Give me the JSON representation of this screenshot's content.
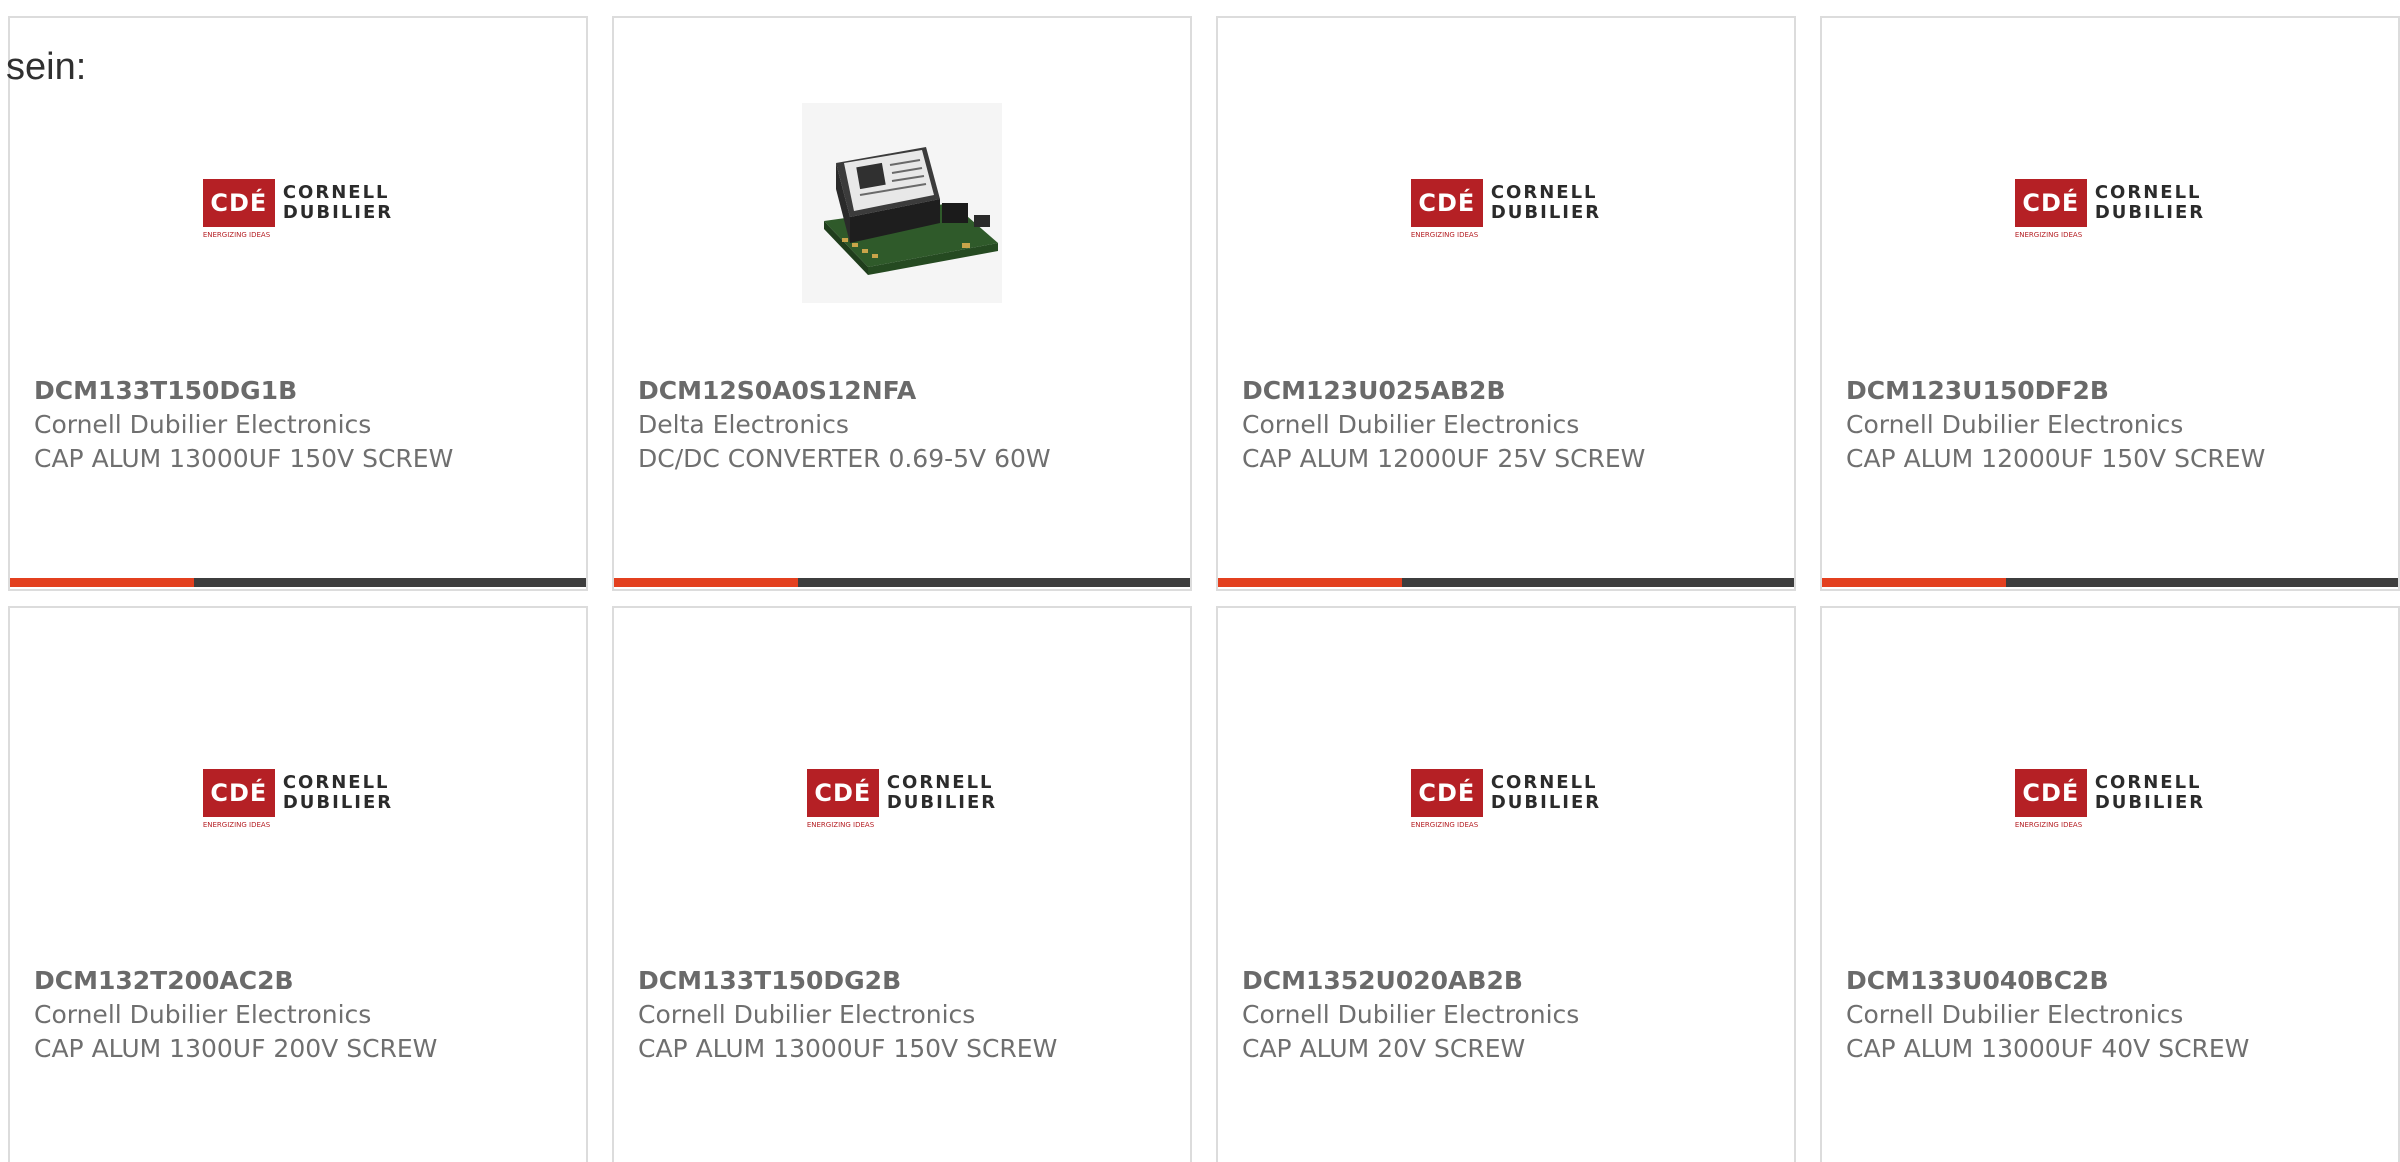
{
  "intro_text": "sein:",
  "logo": {
    "mark": "CDÉ",
    "line1": "CORNELL",
    "line2": "DUBILIER",
    "tagline": "ENERGIZING IDEAS"
  },
  "colors": {
    "accent": "#e3401f",
    "bar_dark": "#3d3d3d",
    "logo_red": "#b52025",
    "border": "#dcdcdc",
    "text": "#6f6f6f"
  },
  "cards": [
    {
      "part": "DCM133T150DG1B",
      "manufacturer": "Cornell Dubilier Electronics",
      "description": "CAP ALUM 13000UF 150V SCREW",
      "image": "cornell-dubilier-logo",
      "progress": 0.32
    },
    {
      "part": "DCM12S0A0S12NFA",
      "manufacturer": "Delta Electronics",
      "description": "DC/DC CONVERTER 0.69-5V 60W",
      "image": "dc-dc-converter-module-photo",
      "progress": 0.32
    },
    {
      "part": "DCM123U025AB2B",
      "manufacturer": "Cornell Dubilier Electronics",
      "description": "CAP ALUM 12000UF 25V SCREW",
      "image": "cornell-dubilier-logo",
      "progress": 0.32
    },
    {
      "part": "DCM123U150DF2B",
      "manufacturer": "Cornell Dubilier Electronics",
      "description": "CAP ALUM 12000UF 150V SCREW",
      "image": "cornell-dubilier-logo",
      "progress": 0.32
    },
    {
      "part": "DCM132T200AC2B",
      "manufacturer": "Cornell Dubilier Electronics",
      "description": "CAP ALUM 1300UF 200V SCREW",
      "image": "cornell-dubilier-logo"
    },
    {
      "part": "DCM133T150DG2B",
      "manufacturer": "Cornell Dubilier Electronics",
      "description": "CAP ALUM 13000UF 150V SCREW",
      "image": "cornell-dubilier-logo"
    },
    {
      "part": "DCM1352U020AB2B",
      "manufacturer": "Cornell Dubilier Electronics",
      "description": "CAP ALUM 20V SCREW",
      "image": "cornell-dubilier-logo"
    },
    {
      "part": "DCM133U040BC2B",
      "manufacturer": "Cornell Dubilier Electronics",
      "description": "CAP ALUM 13000UF 40V SCREW",
      "image": "cornell-dubilier-logo"
    }
  ]
}
